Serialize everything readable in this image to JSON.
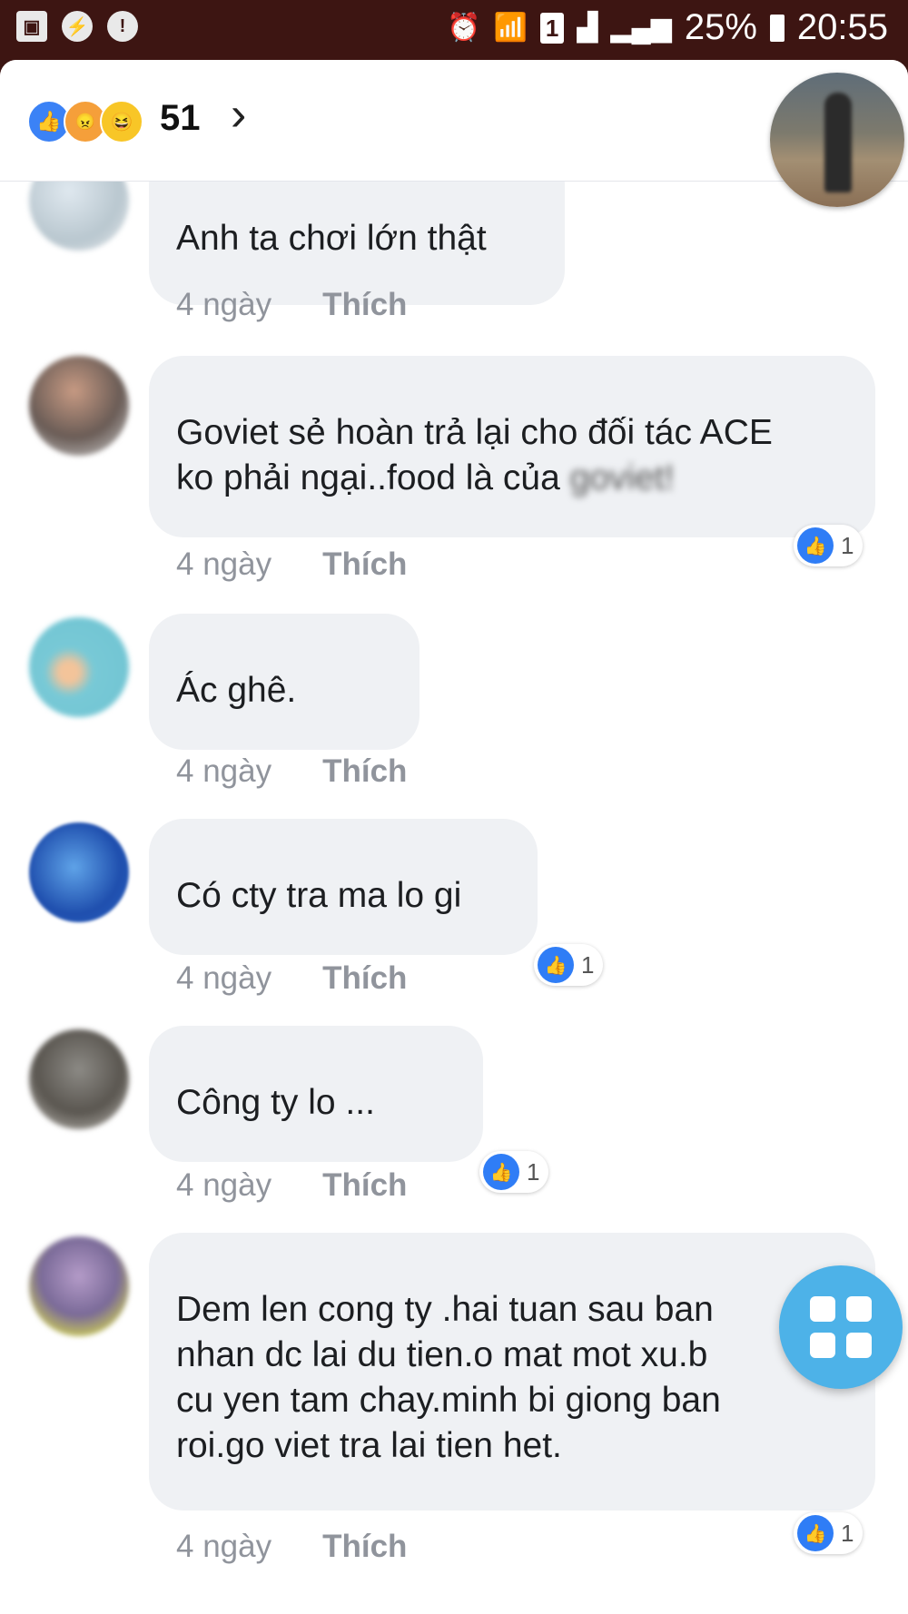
{
  "status_bar": {
    "battery": "25%",
    "time": "20:55",
    "sim": "1"
  },
  "reactions": {
    "count": "51",
    "chevron": "›"
  },
  "comments": [
    {
      "text": "Anh ta chơi lớn thật",
      "time": "4 ngày",
      "like_label": "Thích",
      "reaction_count": ""
    },
    {
      "text": "Goviet sẻ hoàn trả lại cho đối tác ACE\nko phải ngại..food là của ",
      "text_blurred": "goviet!",
      "time": "4 ngày",
      "like_label": "Thích",
      "reaction_count": "1"
    },
    {
      "text": "Ác ghê.",
      "time": "4 ngày",
      "like_label": "Thích",
      "reaction_count": ""
    },
    {
      "text": "Có cty tra ma lo gi",
      "time": "4 ngày",
      "like_label": "Thích",
      "reaction_count": "1"
    },
    {
      "text": "Công ty lo ...",
      "time": "4 ngày",
      "like_label": "Thích",
      "reaction_count": "1"
    },
    {
      "text": "Dem len cong ty .hai tuan sau ban\nnhan dc lai du tien.o mat mot xu.b\ncu yen tam chay.minh bi giong ban\nroi.go viet tra lai tien het.",
      "time": "4 ngày",
      "like_label": "Thích",
      "reaction_count": "1"
    }
  ],
  "colors": {
    "status_bar": "#3d1512",
    "bubble": "#eff1f4",
    "like_blue": "#2f7df6",
    "fab": "#4db2e8"
  }
}
